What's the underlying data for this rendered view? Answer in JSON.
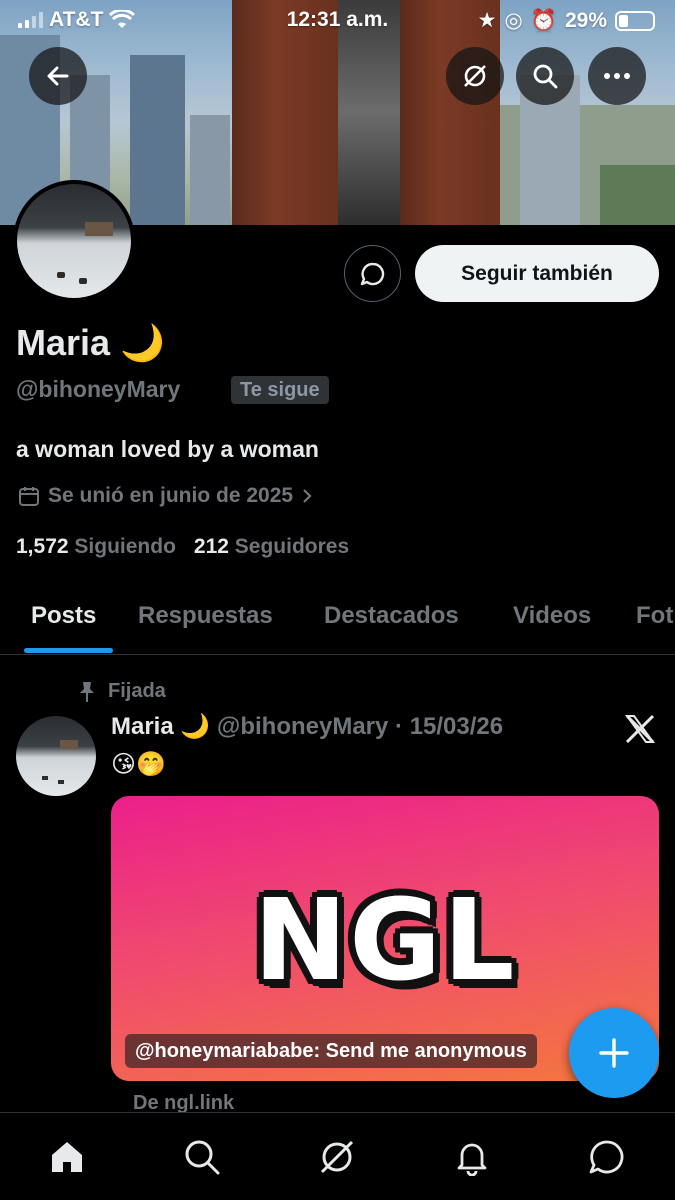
{
  "status_bar": {
    "carrier": "AT&T",
    "time": "12:31 a.m.",
    "battery": "29%"
  },
  "profile": {
    "name": "Maria 🌙",
    "handle": "@bihoneyMary",
    "follows_you_badge": "Te sigue",
    "bio": "a woman loved by a woman",
    "joined": "Se unió en junio de 2025",
    "following_count": "1,572",
    "following_label": "Siguiendo",
    "followers_count": "212",
    "followers_label": "Seguidores",
    "follow_button": "Seguir también"
  },
  "tabs": [
    "Posts",
    "Respuestas",
    "Destacados",
    "Videos",
    "Fot"
  ],
  "pinned_post": {
    "pinned_label": "Fijada",
    "author_name": "Maria 🌙",
    "author_handle": "@bihoneyMary",
    "date": "· 15/03/26",
    "text": "😘🤭",
    "card_logo": "NGL",
    "card_caption": "@honeymariababe: Send me anonymous",
    "card_source": "De ngl.link"
  },
  "colors": {
    "accent": "#1d9bf0",
    "background": "#000000",
    "muted": "#71767b"
  },
  "icons": [
    "back-arrow-icon",
    "grok-icon",
    "search-icon",
    "more-icon",
    "message-icon",
    "calendar-icon",
    "pin-icon",
    "x-logo-icon",
    "plus-icon",
    "home-icon",
    "bell-icon",
    "chat-icon"
  ]
}
